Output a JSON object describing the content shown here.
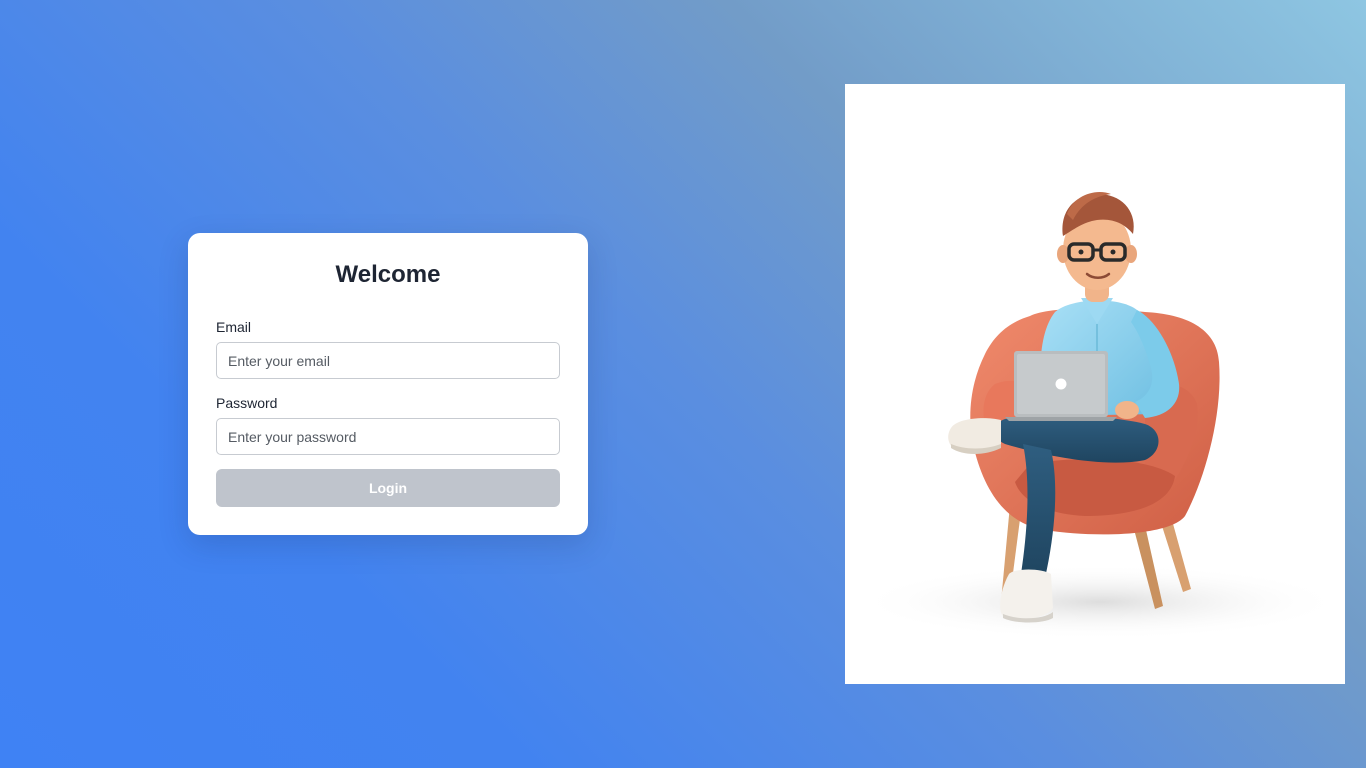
{
  "login": {
    "title": "Welcome",
    "email_label": "Email",
    "email_placeholder": "Enter your email",
    "email_value": "",
    "password_label": "Password",
    "password_placeholder": "Enter your password",
    "password_value": "",
    "submit_label": "Login"
  },
  "illustration": {
    "subject": "person-with-laptop-in-armchair-illustration"
  },
  "colors": {
    "background_gradient_start": "#3f82f4",
    "background_gradient_end": "#8ec6e2",
    "card_background": "#ffffff",
    "title_color": "#1e2533",
    "button_disabled": "#bfc4cc",
    "chair": "#e07458",
    "shirt": "#8fd2ee",
    "jeans": "#2b5573"
  }
}
